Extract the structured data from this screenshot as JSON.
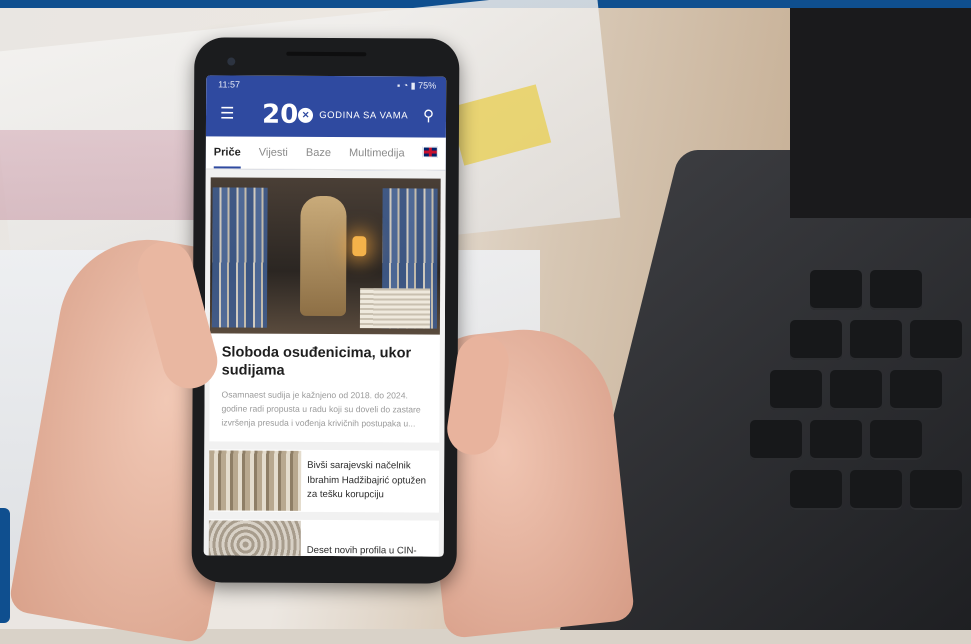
{
  "status_bar": {
    "time": "11:57",
    "battery": "75%"
  },
  "app_bar": {
    "logo_number": "20",
    "logo_text": "GODINA SA VAMA",
    "tabs": [
      {
        "label": "Priče",
        "active": true
      },
      {
        "label": "Vijesti",
        "active": false
      },
      {
        "label": "Baze",
        "active": false
      },
      {
        "label": "Multimedija",
        "active": false
      }
    ],
    "language_flag": "uk-flag-icon"
  },
  "feed": {
    "featured": {
      "headline": "Sloboda osuđenicima, ukor sudijama",
      "excerpt": "Osamnaest sudija je kažnjeno od 2018. do 2024. godine radi propusta u radu koji su doveli do zastare izvršenja presuda i vođenja krivičnih postupaka u..."
    },
    "items": [
      {
        "title": "Bivši sarajevski načelnik Ibrahim Hadžibajrić optužen za tešku korupciju"
      },
      {
        "title": "Deset novih profila u CIN-"
      }
    ]
  },
  "colors": {
    "brand_blue": "#2f4aa0",
    "accent_stripe": "#0f4f8f"
  }
}
